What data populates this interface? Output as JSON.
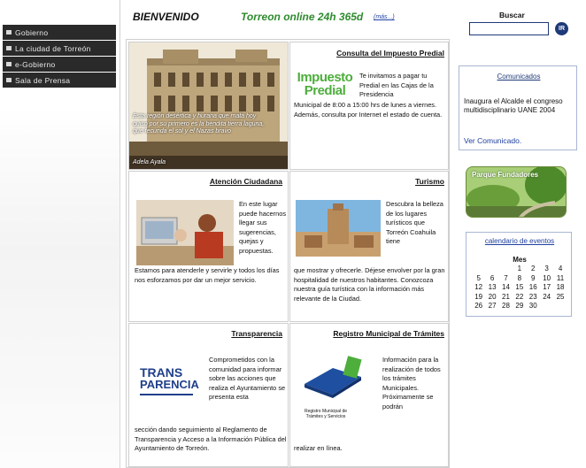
{
  "nav": {
    "items": [
      {
        "label": "Gobierno"
      },
      {
        "label": "La ciudad de Torreón"
      },
      {
        "label": "e-Gobierno"
      },
      {
        "label": "Sala de Prensa"
      }
    ]
  },
  "header": {
    "welcome": "BIENVENIDO",
    "tagline": "Torreon online 24h 365d",
    "more_link": "(más...)"
  },
  "photo": {
    "caption": "Esta región desértica y hurana que mata hoy quiso por su primero es la bendita tierra laguna, que fecunda el sol y el Nazas bravo",
    "author": "Adela Ayala"
  },
  "impuesto": {
    "title": "Consulta del Impuesto Predial",
    "logo_line1": "Impuesto",
    "logo_line2": "Predial",
    "text_side": "Te invitamos a pagar tu Predial en las Cajas de la Presidencia",
    "text_full": "Municipal de 8:00 a 15:00 hrs de lunes a viernes. Además, consulta por Internet el estado de cuenta."
  },
  "atencion": {
    "title": "Atención Ciudadana",
    "text_side": "En este lugar puede hacernos llegar sus sugerencias, quejas y propuestas.",
    "text_full": "Estamos para atenderle y servirle y todos los días nos esforzamos por dar un mejor servicio."
  },
  "turismo": {
    "title": "Turismo",
    "text_side": "Descubra la belleza de los lugares turísticos que Torreón Coahuila tiene",
    "text_full": "que mostrar y ofrecerle. Déjese envolver por la gran hospitalidad de nuestros habitantes. Conozcoza nuestra guía turística con la información más relevante de la Ciudad."
  },
  "transparencia": {
    "title": "Transparencia",
    "logo_line1": "TRANS",
    "logo_line2": "PARENCIA",
    "text_side": "Comprometidos con la comunidad para informar sobre las acciones que realiza el Ayuntamiento se presenta esta",
    "text_full": "sección dando seguimiento al Reglamento de Transparencia y Acceso a la Información Pública del Ayuntamiento de Torreón."
  },
  "registro": {
    "title": "Registro Municipal de Trámites",
    "logo_caption": "Registro Municipal de Trámites y Servicios",
    "text_side": "Información para la realización de todos los trámites Municipales. Próximamente se podrán",
    "text_full": "realizar en línea."
  },
  "search": {
    "label": "Buscar",
    "placeholder": "",
    "button": "IR"
  },
  "comunicados": {
    "title": "Comunicados",
    "text": "Inaugura el Alcalde el congreso multidisciplinario UANE 2004",
    "link": "Ver Comunicado."
  },
  "parque": {
    "label": "Parque Fundadores"
  },
  "calendar": {
    "title": "calendario de eventos",
    "month": "Mes",
    "weeks": [
      [
        "",
        "",
        "",
        "1",
        "2",
        "3",
        "4"
      ],
      [
        "5",
        "6",
        "7",
        "8",
        "9",
        "10",
        "11"
      ],
      [
        "12",
        "13",
        "14",
        "15",
        "16",
        "17",
        "18"
      ],
      [
        "19",
        "20",
        "21",
        "22",
        "23",
        "24",
        "25"
      ],
      [
        "26",
        "27",
        "28",
        "29",
        "30",
        "",
        ""
      ]
    ]
  }
}
